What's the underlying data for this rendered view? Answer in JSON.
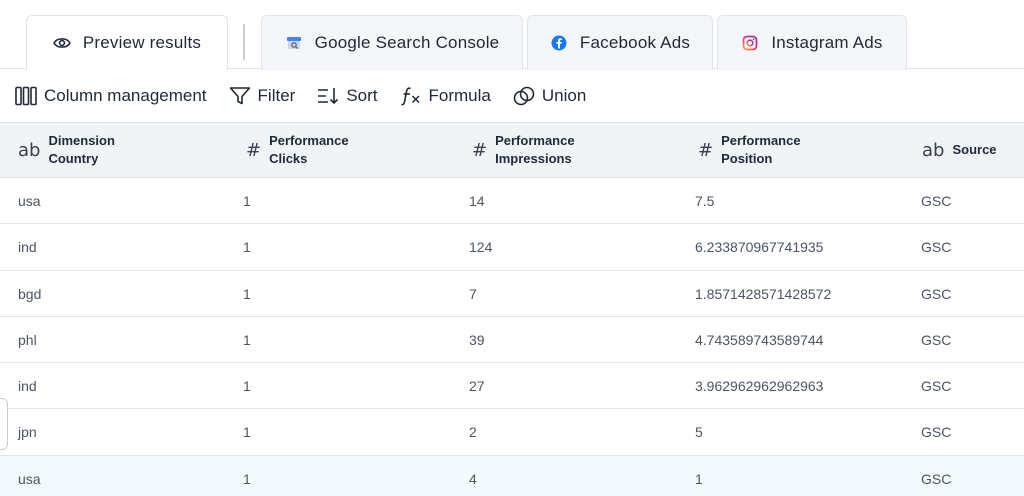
{
  "tabs": [
    {
      "label": "Preview results",
      "icon": "eye-icon"
    },
    {
      "label": "Google Search Console",
      "icon": "google-search-console-icon"
    },
    {
      "label": "Facebook Ads",
      "icon": "facebook-icon"
    },
    {
      "label": "Instagram Ads",
      "icon": "instagram-icon"
    }
  ],
  "toolbar": {
    "column_management": "Column management",
    "filter": "Filter",
    "sort": "Sort",
    "formula": "Formula",
    "union": "Union"
  },
  "table": {
    "columns": [
      {
        "type": "ab",
        "line1": "Dimension",
        "line2": "Country"
      },
      {
        "type": "#",
        "line1": "Performance",
        "line2": "Clicks"
      },
      {
        "type": "#",
        "line1": "Performance",
        "line2": "Impressions"
      },
      {
        "type": "#",
        "line1": "Performance",
        "line2": "Position"
      },
      {
        "type": "ab",
        "line1": "Source",
        "line2": ""
      }
    ],
    "rows": [
      [
        "usa",
        "1",
        "14",
        "7.5",
        "GSC"
      ],
      [
        "ind",
        "1",
        "124",
        "6.233870967741935",
        "GSC"
      ],
      [
        "bgd",
        "1",
        "7",
        "1.8571428571428572",
        "GSC"
      ],
      [
        "phl",
        "1",
        "39",
        "4.743589743589744",
        "GSC"
      ],
      [
        "ind",
        "1",
        "27",
        "3.962962962962963",
        "GSC"
      ],
      [
        "jpn",
        "1",
        "2",
        "5",
        "GSC"
      ],
      [
        "usa",
        "1",
        "4",
        "1",
        "GSC"
      ]
    ]
  },
  "colors": {
    "facebook_blue": "#1877f2",
    "header_bg": "#f1f4f7",
    "highlight_row": "#f3f9fc"
  }
}
